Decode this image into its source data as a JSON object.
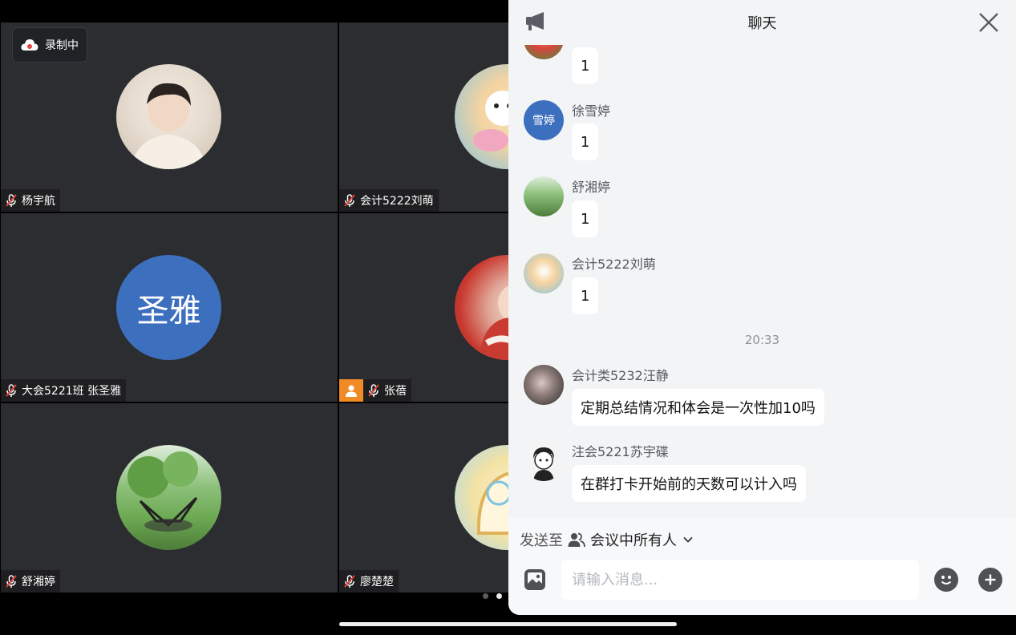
{
  "recording": {
    "label": "录制中"
  },
  "participants": [
    {
      "name": "杨宇航",
      "avatar_kind": "photo",
      "avatar_colors": [
        "#e9e4dc",
        "#c9b7a2"
      ]
    },
    {
      "name": "会计5222刘萌",
      "avatar_kind": "photo",
      "avatar_colors": [
        "#7fc3e6",
        "#f4d3a0"
      ]
    },
    {
      "name": "大会5221班 张圣雅",
      "avatar_kind": "text",
      "avatar_text": "圣雅",
      "avatar_colors": [
        "#3d6fbf"
      ]
    },
    {
      "name": "张蓓",
      "avatar_kind": "photo",
      "host": true,
      "avatar_colors": [
        "#c93a30",
        "#f2e2d2"
      ]
    },
    {
      "name": "舒湘婷",
      "avatar_kind": "photo",
      "avatar_colors": [
        "#6ca852",
        "#dfeedd"
      ]
    },
    {
      "name": "廖楚楚",
      "avatar_kind": "photo",
      "avatar_colors": [
        "#f3e2a3",
        "#a9d9ef"
      ]
    }
  ],
  "chat": {
    "title": "聊天",
    "messages": [
      {
        "sender": "",
        "text": "1",
        "avatar_kind": "photo",
        "avatar_colors": [
          "#4f8a3a",
          "#d8453d"
        ]
      },
      {
        "sender": "徐雪婷",
        "text": "1",
        "avatar_kind": "text",
        "avatar_text": "雪婷",
        "avatar_colors": [
          "#3d6fbf"
        ]
      },
      {
        "sender": "舒湘婷",
        "text": "1",
        "avatar_kind": "photo",
        "avatar_colors": [
          "#6ca852",
          "#dfeedd"
        ]
      },
      {
        "sender": "会计5222刘萌",
        "text": "1",
        "avatar_kind": "photo",
        "avatar_colors": [
          "#7fc3e6",
          "#f4d3a0"
        ]
      },
      {
        "sender": "会计类5232汪静",
        "text": "定期总结情况和体会是一次性加10吗",
        "avatar_kind": "photo",
        "avatar_colors": [
          "#2a2a2a",
          "#d9c8c2"
        ]
      },
      {
        "sender": "注会5221苏宇碟",
        "text": "在群打卡开始前的天数可以计入吗",
        "avatar_kind": "photo",
        "avatar_colors": [
          "#f4f4f4",
          "#222222"
        ]
      }
    ],
    "time_divider": "20:33",
    "send_to_label": "发送至",
    "send_to_target": "会议中所有人",
    "input_placeholder": "请输入消息..."
  },
  "pager": {
    "page_count": 2,
    "active_page": 2
  }
}
